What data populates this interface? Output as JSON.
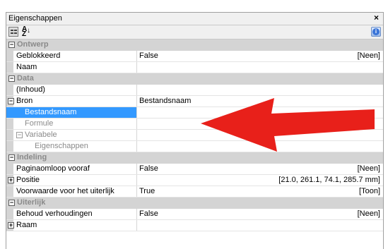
{
  "panel": {
    "title": "Eigenschappen",
    "close_glyph": "×",
    "icons": [
      "categorized-icon",
      "sort-alphabetical-icon",
      "info-icon"
    ],
    "alpha_glyph_top": "A",
    "alpha_glyph_bottom": "Z",
    "info_glyph": "i"
  },
  "colors": {
    "category_band": "#d4d4d4",
    "selection": "#3399ff",
    "annotation_arrow": "#e8201a"
  },
  "rows": {
    "ontwerp": {
      "label": "Ontwerp",
      "expander": "−"
    },
    "geblokkeerd": {
      "label": "Geblokkeerd",
      "value": "False",
      "value_right": "[Neen]"
    },
    "naam": {
      "label": "Naam"
    },
    "data": {
      "label": "Data",
      "expander": "−"
    },
    "inhoud": {
      "label": "(Inhoud)"
    },
    "bron": {
      "label": "Bron",
      "value": "Bestandsnaam",
      "expander": "−"
    },
    "bestandsnaam": {
      "label": "Bestandsnaam"
    },
    "formule": {
      "label": "Formule"
    },
    "variabele": {
      "label": "Variabele",
      "expander": "−"
    },
    "eigenschappen": {
      "label": "Eigenschappen"
    },
    "indeling": {
      "label": "Indeling",
      "expander": "−"
    },
    "paginaomloop": {
      "label": "Paginaomloop vooraf",
      "value": "False",
      "value_right": "[Neen]"
    },
    "positie": {
      "label": "Positie",
      "value_right": "[21.0, 261.1, 74.1, 285.7 mm]",
      "expander": "+"
    },
    "voorwaarde": {
      "label": "Voorwaarde voor het uiterlijk",
      "value": "True",
      "value_right": "[Toon]"
    },
    "uiterlijk": {
      "label": "Uiterlijk",
      "expander": "−"
    },
    "behoud": {
      "label": "Behoud verhoudingen",
      "value": "False",
      "value_right": "[Neen]"
    },
    "raam": {
      "label": "Raam",
      "expander": "+"
    }
  }
}
